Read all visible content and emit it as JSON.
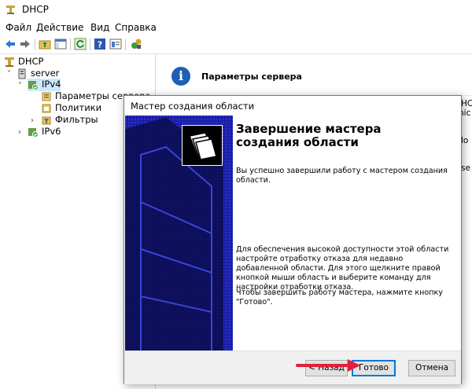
{
  "window": {
    "title": "DHCP"
  },
  "menu": [
    "Файл",
    "Действие",
    "Вид",
    "Справка"
  ],
  "toolbar": {
    "icons": [
      "back-arrow-icon",
      "forward-arrow-icon",
      "up-folder-icon",
      "console-tree-icon",
      "refresh-icon",
      "help-icon",
      "properties-icon",
      "action-icon"
    ]
  },
  "tree": {
    "root": "DHCP",
    "server": "server",
    "ipv4": "IPv4",
    "server_options": "Параметры сервера",
    "policies": "Политики",
    "filters": "Фильтры",
    "ipv6": "IPv6"
  },
  "rightpane": {
    "header_title": "Параметры сервера",
    "fragments": [
      "HC",
      "hic",
      "lo",
      "se"
    ]
  },
  "dialog": {
    "title": "Мастер создания области",
    "heading": "Завершение мастера создания области",
    "para1": "Вы успешно завершили работу с мастером создания области.",
    "para2": "Для обеспечения высокой доступности этой области настройте отработку отказа для недавно добавленной области. Для этого щелкните правой кнопкой мыши область и выберите команду для настройки отработки отказа.",
    "para3": "Чтобы завершить работу мастера, нажмите кнопку \"Готово\".",
    "back": "< Назад",
    "finish": "Готово",
    "cancel": "Отмена"
  },
  "colors": {
    "banner": "#1b1ea6",
    "accent": "#0078d7",
    "annotation": "#e0203a"
  }
}
